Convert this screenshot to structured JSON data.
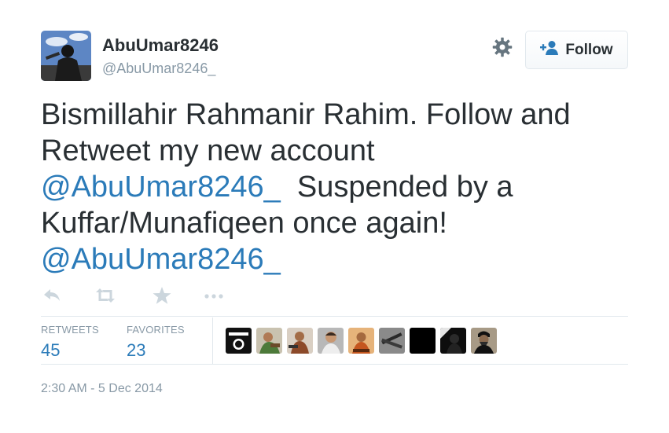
{
  "user": {
    "display_name": "AbuUmar8246",
    "handle": "@AbuUmar8246_"
  },
  "header": {
    "follow_label": "Follow",
    "settings_icon": "gear-icon",
    "follow_icon": "add-user-icon"
  },
  "tweet": {
    "line1": "Bismillahir Rahmanir Rahim. Follow and",
    "line2": "Retweet my new account",
    "mention1": "@AbuUmar8246_",
    "line3_rest": "  Suspended by a",
    "line4": "Kuffar/Munafiqeen once again!",
    "mention2": "@AbuUmar8246_"
  },
  "actions": [
    "reply-icon",
    "retweet-icon",
    "favorite-icon",
    "more-icon"
  ],
  "stats": {
    "retweets_label": "RETWEETS",
    "retweets_count": "45",
    "favorites_label": "FAVORITES",
    "favorites_count": "23"
  },
  "timestamp": "2:30 AM - 5 Dec 2014",
  "colors": {
    "link": "#2b7bb9",
    "text": "#292f33",
    "muted": "#8899a6",
    "border": "#e1e8ed"
  }
}
